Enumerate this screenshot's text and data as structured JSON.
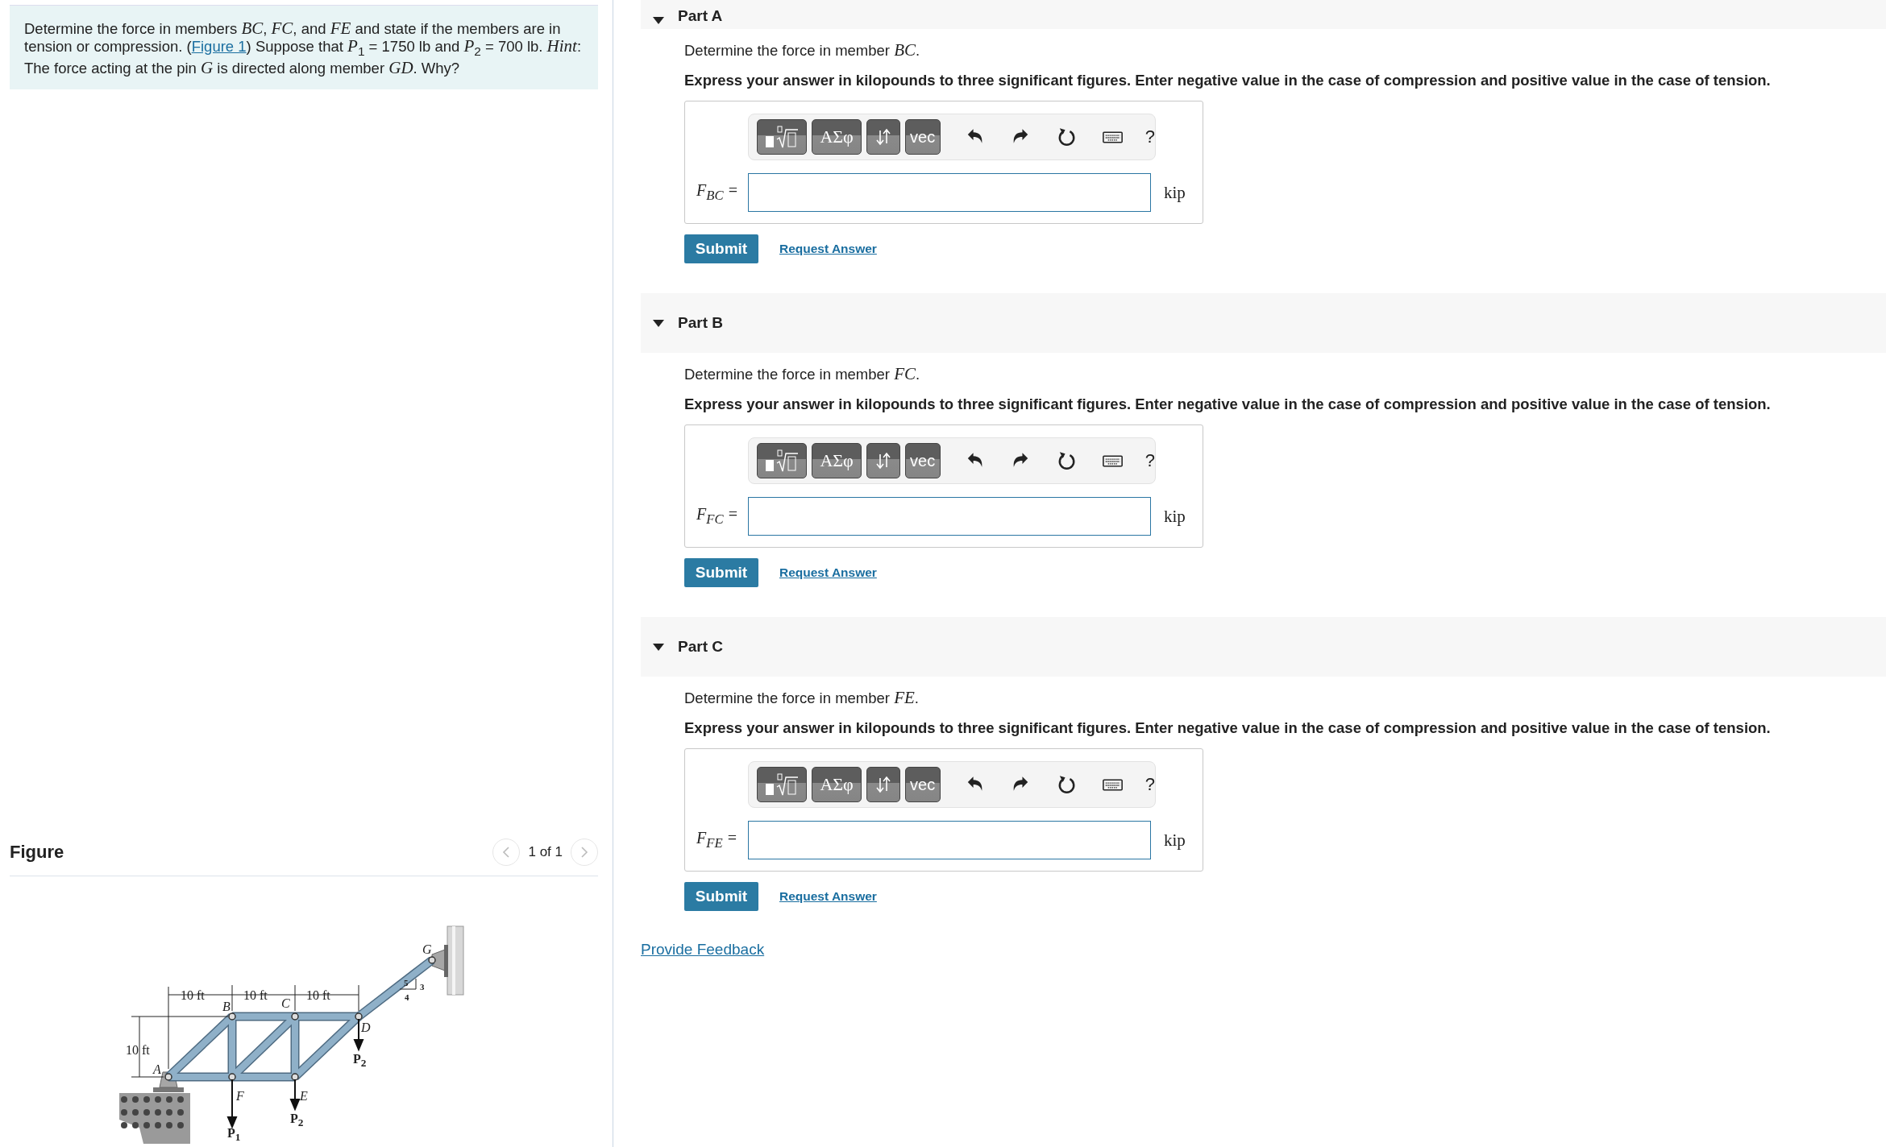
{
  "problem": {
    "before": "Determine the force in members *BC*, *FC*, and *FE* and state if the members are in tension or compression. (",
    "link": "Figure 1",
    "after": ") Suppose that *P*$_{1}$ = 1750 lb and *P*$_{2}$ = 700 lb. *Hint*: The force acting at the pin *G* is directed along member *GD*. Why?"
  },
  "figure": {
    "title": "Figure",
    "pager": "1 of 1",
    "labels": [
      {
        "text": "10 ft"
      },
      {
        "text": "10 ft"
      },
      {
        "text": "10 ft"
      },
      {
        "text": "10 ft"
      },
      {
        "text": "A"
      },
      {
        "text": "B"
      },
      {
        "text": "C"
      },
      {
        "text": "D"
      },
      {
        "text": "E"
      },
      {
        "text": "F"
      },
      {
        "text": "G"
      },
      {
        "text": "P$_{1}$"
      },
      {
        "text": "P$_{2}$"
      },
      {
        "text": "P$_{2}$"
      },
      {
        "text": "5"
      },
      {
        "text": "3"
      },
      {
        "text": "4"
      }
    ]
  },
  "parts": [
    {
      "title": "Part A",
      "expanded": true,
      "prompt": "Determine the force in member *BC*.",
      "instruction": "Express your answer in kilopounds to three significant figures. Enter negative value in the case of compression and positive value in the case of tension.",
      "tool_labels": [
        "ΑΣφ",
        "vec",
        "?"
      ],
      "label": "F$_{BC}$ =",
      "unit": "kip",
      "submit": "Submit",
      "request": "Request Answer"
    },
    {
      "title": "Part B",
      "expanded": true,
      "prompt": "Determine the force in member *FC*.",
      "instruction": "Express your answer in kilopounds to three significant figures. Enter negative value in the case of compression and positive value in the case of tension.",
      "tool_labels": [
        "ΑΣφ",
        "vec",
        "?"
      ],
      "label": "F$_{FC}$ =",
      "unit": "kip",
      "submit": "Submit",
      "request": "Request Answer"
    },
    {
      "title": "Part C",
      "expanded": true,
      "prompt": "Determine the force in member *FE*.",
      "instruction": "Express your answer in kilopounds to three significant figures. Enter negative value in the case of compression and positive value in the case of tension.",
      "tool_labels": [
        "ΑΣφ",
        "vec",
        "?"
      ],
      "label": "F$_{FE}$ =",
      "unit": "kip",
      "submit": "Submit",
      "request": "Request Answer"
    }
  ],
  "feedback_link": "Provide Feedback"
}
